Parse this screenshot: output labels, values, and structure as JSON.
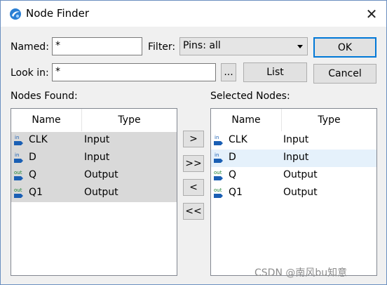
{
  "window": {
    "title": "Node Finder",
    "app_icon": "quartus-icon",
    "close_icon": "close-icon"
  },
  "form": {
    "named_label": "Named:",
    "named_value": "*",
    "filter_label": "Filter:",
    "filter_value": "Pins: all",
    "lookin_label": "Look in:",
    "lookin_value": "*",
    "browse_label": "...",
    "list_label": "List",
    "ok_label": "OK",
    "cancel_label": "Cancel"
  },
  "nodes_found": {
    "label": "Nodes Found:",
    "columns": {
      "name": "Name",
      "type": "Type"
    },
    "rows": [
      {
        "direction": "in",
        "name": "CLK",
        "type": "Input"
      },
      {
        "direction": "in",
        "name": "D",
        "type": "Input"
      },
      {
        "direction": "out",
        "name": "Q",
        "type": "Output"
      },
      {
        "direction": "out",
        "name": "Q1",
        "type": "Output"
      }
    ]
  },
  "transfer": {
    "add": ">",
    "add_all": ">>",
    "remove": "<",
    "remove_all": "<<"
  },
  "selected_nodes": {
    "label": "Selected Nodes:",
    "columns": {
      "name": "Name",
      "type": "Type"
    },
    "rows": [
      {
        "direction": "in",
        "name": "CLK",
        "type": "Input"
      },
      {
        "direction": "in",
        "name": "D",
        "type": "Input"
      },
      {
        "direction": "out",
        "name": "Q",
        "type": "Output"
      },
      {
        "direction": "out",
        "name": "Q1",
        "type": "Output"
      }
    ]
  },
  "colors": {
    "accent": "#0078d7",
    "selection_gray": "#d9d9d9",
    "hover_blue": "#e5f1fb",
    "pin_in": "#1a5fb4",
    "pin_out": "#1a7f2e"
  },
  "watermark": "CSDN @南风bu知意"
}
